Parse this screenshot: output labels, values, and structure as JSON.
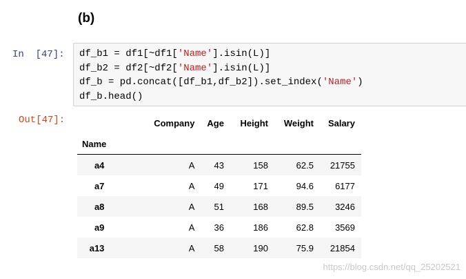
{
  "heading": "(b)",
  "input_prompt": "In  [47]:",
  "output_prompt": "Out[47]:",
  "code": {
    "line1": {
      "a": "df_b1 = df1[~df1[",
      "s": "'Name'",
      "b": "].isin(L)]"
    },
    "line2": {
      "a": "df_b2 = df2[~df2[",
      "s": "'Name'",
      "b": "].isin(L)]"
    },
    "line3": {
      "a": "df_b = pd.concat([df_b1,df_b2]).set_index(",
      "s": "'Name'",
      "b": ")"
    },
    "line4": "df_b.head()"
  },
  "table": {
    "columns": [
      "Company",
      "Age",
      "Height",
      "Weight",
      "Salary"
    ],
    "index_name": "Name",
    "rows": [
      {
        "name": "a4",
        "company": "A",
        "age": "43",
        "height": "158",
        "weight": "62.5",
        "salary": "21755"
      },
      {
        "name": "a7",
        "company": "A",
        "age": "49",
        "height": "171",
        "weight": "94.6",
        "salary": "6177"
      },
      {
        "name": "a8",
        "company": "A",
        "age": "51",
        "height": "168",
        "weight": "89.5",
        "salary": "3246"
      },
      {
        "name": "a9",
        "company": "A",
        "age": "36",
        "height": "186",
        "weight": "62.8",
        "salary": "3569"
      },
      {
        "name": "a13",
        "company": "A",
        "age": "58",
        "height": "190",
        "weight": "75.9",
        "salary": "21854"
      }
    ]
  },
  "watermark": "https://blog.csdn.net/qq_25202521",
  "colors": {
    "input_prompt": "#303f9f",
    "output_prompt": "#d84315",
    "string_literal": "#ba2121",
    "cell_background": "#f7f7f7"
  }
}
